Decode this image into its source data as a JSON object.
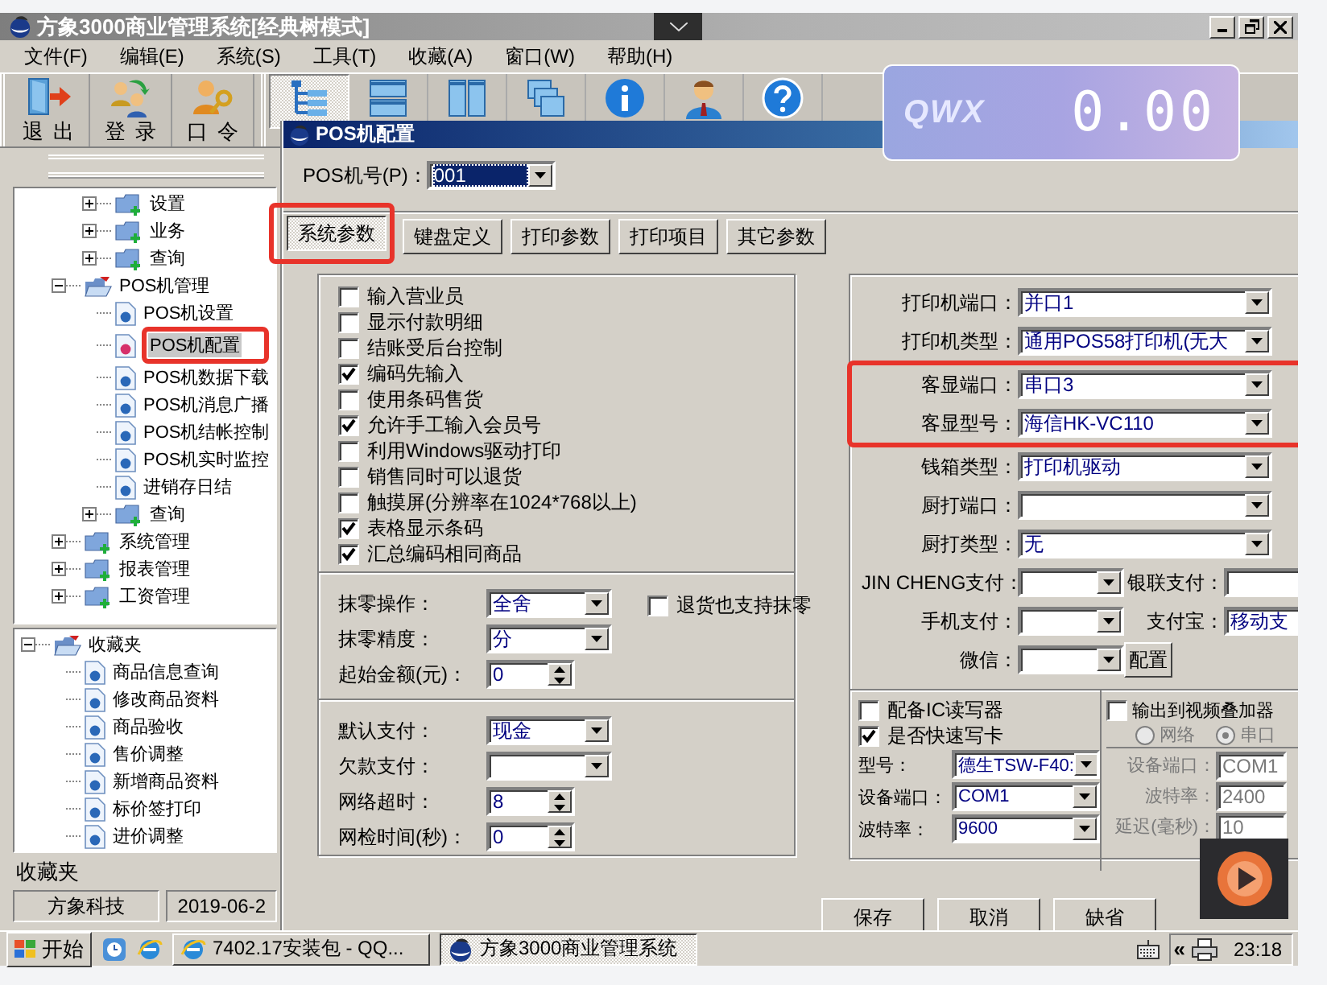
{
  "window": {
    "title": "方象3000商业管理系统[经典树模式]"
  },
  "menu": [
    "文件(F)",
    "编辑(E)",
    "系统(S)",
    "工具(T)",
    "收藏(A)",
    "窗口(W)",
    "帮助(H)"
  ],
  "toolbar": {
    "buttons": [
      {
        "label": "退出",
        "kind": "exit"
      },
      {
        "label": "登录",
        "kind": "login"
      },
      {
        "label": "口令",
        "kind": "password"
      }
    ],
    "icon_buttons": [
      {
        "kind": "tree",
        "selected": true
      },
      {
        "kind": "rows",
        "selected": false
      },
      {
        "kind": "columns",
        "selected": false
      },
      {
        "kind": "cascade",
        "selected": false
      },
      {
        "kind": "info",
        "selected": false
      },
      {
        "kind": "user",
        "selected": false
      },
      {
        "kind": "help",
        "selected": false
      }
    ]
  },
  "display": {
    "logo": "QWX",
    "amount": "0.00"
  },
  "nav_tree": {
    "items": [
      {
        "children": [
          {
            "label": "设置",
            "kind": "folder",
            "expanded": false,
            "selected": false
          },
          {
            "label": "业务",
            "kind": "folder",
            "expanded": false,
            "selected": false
          },
          {
            "label": "查询",
            "kind": "folder",
            "expanded": false,
            "selected": false
          }
        ]
      },
      {
        "label": "POS机管理",
        "kind": "folder",
        "expanded": true,
        "selected": false,
        "children": [
          {
            "label": "POS机设置",
            "kind": "page",
            "selected": false,
            "highlighted": false
          },
          {
            "label": "POS机配置",
            "kind": "page",
            "selected": true,
            "highlighted": true
          },
          {
            "label": "POS机数据下载",
            "kind": "page",
            "selected": false,
            "highlighted": false
          },
          {
            "label": "POS机消息广播",
            "kind": "page",
            "selected": false,
            "highlighted": false
          },
          {
            "label": "POS机结帐控制",
            "kind": "page",
            "selected": false,
            "highlighted": false
          },
          {
            "label": "POS机实时监控",
            "kind": "page",
            "selected": false,
            "highlighted": false
          },
          {
            "label": "进销存日结",
            "kind": "page",
            "selected": false,
            "highlighted": false
          },
          {
            "label": "查询",
            "kind": "folder",
            "expanded": false,
            "selected": false,
            "highlighted": false
          }
        ]
      },
      {
        "label": "系统管理",
        "kind": "folder",
        "expanded": false,
        "selected": false
      },
      {
        "label": "报表管理",
        "kind": "folder",
        "expanded": false,
        "selected": false
      },
      {
        "label": "工资管理",
        "kind": "folder",
        "expanded": false,
        "selected": false
      }
    ]
  },
  "favorites": {
    "items": [
      {
        "label": "收藏夹",
        "kind": "folder",
        "expanded": true,
        "selected": false,
        "children": [
          {
            "label": "商品信息查询",
            "kind": "page",
            "selected": false
          },
          {
            "label": "修改商品资料",
            "kind": "page",
            "selected": false
          },
          {
            "label": "商品验收",
            "kind": "page",
            "selected": false
          },
          {
            "label": "售价调整",
            "kind": "page",
            "selected": false
          },
          {
            "label": "新增商品资料",
            "kind": "page",
            "selected": false
          },
          {
            "label": "标价签打印",
            "kind": "page",
            "selected": false
          },
          {
            "label": "进价调整",
            "kind": "page",
            "selected": false
          }
        ]
      }
    ],
    "caption": "收藏夹"
  },
  "status_bar": [
    "方象科技",
    "2019-06-2"
  ],
  "dialog": {
    "title": "POS机配置",
    "pos_number": {
      "label": "POS机号(P)：",
      "value": "001"
    },
    "tabs": [
      {
        "label": "系统参数",
        "selected": true,
        "highlighted": true
      },
      {
        "label": "键盘定义",
        "selected": false,
        "highlighted": false
      },
      {
        "label": "打印参数",
        "selected": false,
        "highlighted": false
      },
      {
        "label": "打印项目",
        "selected": false,
        "highlighted": false
      },
      {
        "label": "其它参数",
        "selected": false,
        "highlighted": false
      }
    ],
    "options": [
      {
        "label": "输入营业员",
        "checked": false
      },
      {
        "label": "显示付款明细",
        "checked": false
      },
      {
        "label": "结账受后台控制",
        "checked": false
      },
      {
        "label": "编码先输入",
        "checked": true
      },
      {
        "label": "使用条码售货",
        "checked": false
      },
      {
        "label": "允许手工输入会员号",
        "checked": true
      },
      {
        "label": "利用Windows驱动打印",
        "checked": false
      },
      {
        "label": "销售同时可以退货",
        "checked": false
      },
      {
        "label": "触摸屏(分辨率在1024*768以上)",
        "checked": false
      },
      {
        "label": "表格显示条码",
        "checked": true
      },
      {
        "label": "汇总编码相同商品",
        "checked": true
      }
    ],
    "rounding_fields": [
      {
        "label": "抹零操作：",
        "value": "全舍",
        "kind": "combo"
      },
      {
        "label": "抹零精度：",
        "value": "分",
        "kind": "combo"
      },
      {
        "label": "起始金额(元)：",
        "value": "0",
        "kind": "spin"
      }
    ],
    "return_rounding": {
      "label": "退货也支持抹零",
      "checked": false
    },
    "payment_fields": [
      {
        "label": "默认支付：",
        "value": "现金",
        "kind": "combo"
      },
      {
        "label": "欠款支付：",
        "kind": "combo"
      },
      {
        "label": "网络超时：",
        "value": "8",
        "kind": "spin"
      },
      {
        "label": "网检时间(秒)：",
        "value": "0",
        "kind": "spin"
      }
    ],
    "device_fields": [
      {
        "label": "打印机端口：",
        "value": "并口1",
        "highlighted": false
      },
      {
        "label": "打印机类型：",
        "value": "通用POS58打印机(无大",
        "highlighted": false
      },
      {
        "label": "客显端口：",
        "value": "串口3",
        "highlighted": true
      },
      {
        "label": "客显型号：",
        "value": "海信HK-VC110",
        "highlighted": true
      },
      {
        "label": "钱箱类型：",
        "value": "打印机驱动",
        "highlighted": false
      },
      {
        "label": "厨打端口：",
        "highlighted": false
      },
      {
        "label": "厨打类型：",
        "value": "无",
        "highlighted": false
      }
    ],
    "pay_rows": [
      {
        "label": "JIN CHENG支付：",
        "extra": {
          "label": "银联支付：",
          "kind": "field"
        }
      },
      {
        "label": "手机支付：",
        "extra": {
          "label": "支付宝：",
          "value": "移动支",
          "kind": "field"
        }
      },
      {
        "label": "微信：",
        "extra": {
          "label": "配置",
          "kind": "button"
        }
      }
    ],
    "ic_reader": {
      "options": [
        {
          "label": "配备IC读写器",
          "checked": false
        },
        {
          "label": "是否快速写卡",
          "checked": true
        }
      ],
      "fields": [
        {
          "label": "型号：",
          "value": "德生TSW-F40:"
        },
        {
          "label": "设备端口：",
          "value": "COM1"
        },
        {
          "label": "波特率：",
          "value": "9600"
        }
      ]
    },
    "video_overlay": {
      "label": "输出到视频叠加器",
      "checked": false,
      "disabled": true,
      "modes": [
        {
          "label": "网络",
          "selected": false
        },
        {
          "label": "串口",
          "selected": true
        }
      ],
      "fields": [
        {
          "label": "设备端口：",
          "value": "COM1"
        },
        {
          "label": "波特率：",
          "value": "2400"
        },
        {
          "label": "延迟(毫秒)：",
          "value": "10"
        }
      ]
    },
    "buttons": [
      "保存",
      "取消",
      "缺省"
    ]
  },
  "taskbar": {
    "start": "开始",
    "tasks": [
      {
        "label": "7402.17安装包 - QQ...",
        "selected": false
      },
      {
        "label": "方象3000商业管理系统",
        "selected": true
      }
    ],
    "tray_toggle": "«",
    "clock": "23:18"
  }
}
